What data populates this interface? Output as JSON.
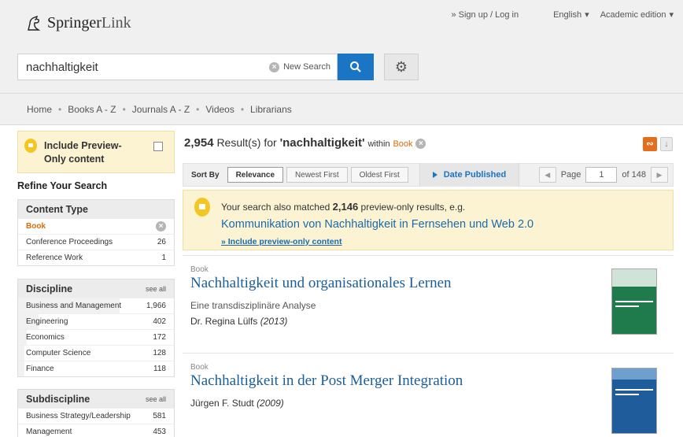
{
  "header": {
    "logo_text": "Springer",
    "logo_link": "Link",
    "signup": "» Sign up / Log in",
    "language": "English",
    "edition": "Academic edition"
  },
  "search": {
    "query": "nachhaltigkeit",
    "new_search": "New Search"
  },
  "nav": {
    "items": [
      "Home",
      "Books A - Z",
      "Journals A - Z",
      "Videos",
      "Librarians"
    ],
    "separator": "•"
  },
  "sidebar": {
    "preview_label": "Include Preview-Only content",
    "refine_title": "Refine Your Search",
    "content_type": {
      "title": "Content Type",
      "items": [
        {
          "label": "Book",
          "count": "",
          "active": true
        },
        {
          "label": "Conference Proceedings",
          "count": "26"
        },
        {
          "label": "Reference Work",
          "count": "1"
        }
      ]
    },
    "discipline": {
      "title": "Discipline",
      "see_all": "see all",
      "items": [
        {
          "label": "Business and Management",
          "count": "1,966",
          "share": 1.0
        },
        {
          "label": "Engineering",
          "count": "402",
          "share": 0.204
        },
        {
          "label": "Economics",
          "count": "172",
          "share": 0.087
        },
        {
          "label": "Computer Science",
          "count": "128",
          "share": 0.065
        },
        {
          "label": "Finance",
          "count": "118",
          "share": 0.06
        }
      ]
    },
    "subdiscipline": {
      "title": "Subdiscipline",
      "see_all": "see all",
      "items": [
        {
          "label": "Business Strategy/Leadership",
          "count": "581"
        },
        {
          "label": "Management",
          "count": "453"
        }
      ]
    }
  },
  "results": {
    "count": "2,954",
    "label": "Result(s) for",
    "query": "'nachhaltigkeit'",
    "within": "within",
    "scope": "Book",
    "sort_by": "Sort By",
    "sort_options": [
      "Relevance",
      "Newest First",
      "Oldest First"
    ],
    "date_published": "Date Published",
    "page_label": "Page",
    "page_value": "1",
    "page_of": "of 148",
    "notice": {
      "line_pre": "Your search also matched",
      "line_count": "2,146",
      "line_post": "preview-only results, e.g.",
      "link": "Kommunikation von Nachhaltigkeit in Fernsehen und Web 2.0",
      "include": "» Include preview-only content"
    },
    "items": [
      {
        "type": "Book",
        "title": "Nachhaltigkeit und organisationales Lernen",
        "subtitle": "Eine transdisziplinäre Analyse",
        "author": "Dr. Regina Lülfs",
        "year": "(2013)",
        "cover_color": "#1f7a4c"
      },
      {
        "type": "Book",
        "title": "Nachhaltigkeit in der Post Merger Integration",
        "subtitle": "",
        "author": "Jürgen F. Studt",
        "year": "(2009)",
        "cover_color": "#1f5c9c"
      }
    ]
  },
  "colors": {
    "accent_blue": "#1a75c4",
    "link_blue": "#1a5e99",
    "orange": "#d56d0d",
    "preview_yellow": "#fcf3d2"
  }
}
